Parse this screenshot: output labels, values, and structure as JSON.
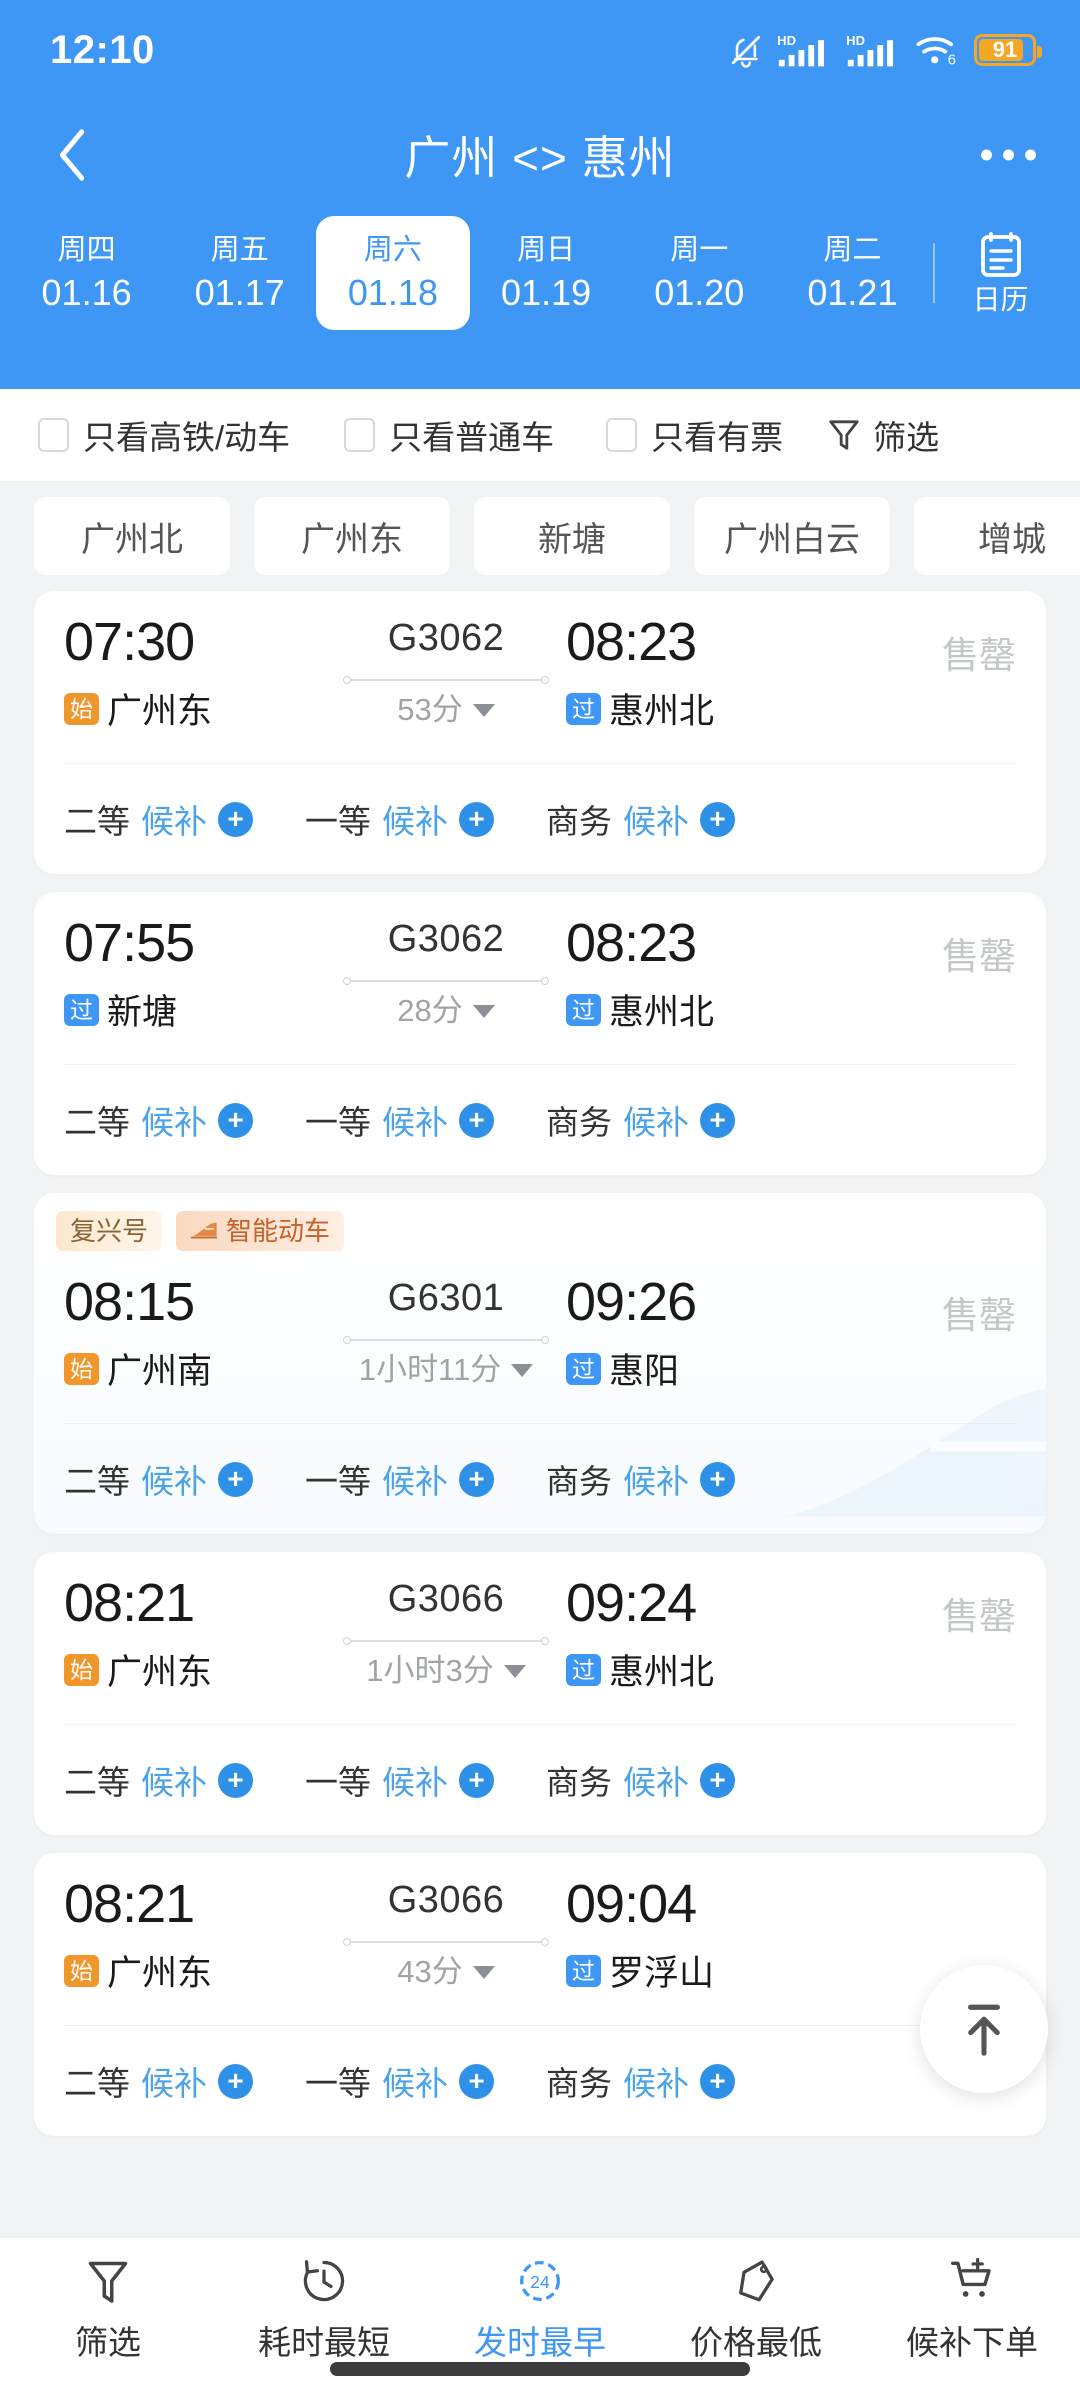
{
  "status_bar": {
    "time": "12:10",
    "battery_percent": "91",
    "icons": [
      "bell-muted-icon",
      "hd-signal-icon",
      "hd-signal-icon",
      "wifi6-icon",
      "battery-icon"
    ]
  },
  "header": {
    "title": "广州 <> 惠州",
    "back_icon": "chevron-left-icon",
    "more_icon": "more-dots-icon",
    "accent_color": "#3E96F5"
  },
  "dates": {
    "tabs": [
      {
        "dow": "周四",
        "date": "01.16",
        "active": false
      },
      {
        "dow": "周五",
        "date": "01.17",
        "active": false
      },
      {
        "dow": "周六",
        "date": "01.18",
        "active": true
      },
      {
        "dow": "周日",
        "date": "01.19",
        "active": false
      },
      {
        "dow": "周一",
        "date": "01.20",
        "active": false
      },
      {
        "dow": "周二",
        "date": "01.21",
        "active": false
      }
    ],
    "calendar_label": "日历",
    "calendar_icon": "calendar-icon"
  },
  "filters": {
    "checks": [
      {
        "label": "只看高铁/动车",
        "checked": false
      },
      {
        "label": "只看普通车",
        "checked": false
      },
      {
        "label": "只看有票",
        "checked": false
      }
    ],
    "filter_button": {
      "label": "筛选",
      "icon": "funnel-icon"
    }
  },
  "stations": {
    "chips": [
      "广州北",
      "广州东",
      "新塘",
      "广州白云",
      "增城"
    ]
  },
  "trains": [
    {
      "badges": [],
      "depart_time": "07:30",
      "depart_badge": "始",
      "depart_badge_type": "start",
      "depart_station": "广州东",
      "train_no": "G3062",
      "duration": "53分",
      "arrive_time": "08:23",
      "arrive_badge": "过",
      "arrive_badge_type": "pass",
      "arrive_station": "惠州北",
      "status": "售罄",
      "seats": [
        {
          "class": "二等",
          "state": "候补",
          "action_icon": "plus-icon"
        },
        {
          "class": "一等",
          "state": "候补",
          "action_icon": "plus-icon"
        },
        {
          "class": "商务",
          "state": "候补",
          "action_icon": "plus-icon"
        }
      ]
    },
    {
      "badges": [],
      "depart_time": "07:55",
      "depart_badge": "过",
      "depart_badge_type": "pass",
      "depart_station": "新塘",
      "train_no": "G3062",
      "duration": "28分",
      "arrive_time": "08:23",
      "arrive_badge": "过",
      "arrive_badge_type": "pass",
      "arrive_station": "惠州北",
      "status": "售罄",
      "seats": [
        {
          "class": "二等",
          "state": "候补",
          "action_icon": "plus-icon"
        },
        {
          "class": "一等",
          "state": "候补",
          "action_icon": "plus-icon"
        },
        {
          "class": "商务",
          "state": "候补",
          "action_icon": "plus-icon"
        }
      ]
    },
    {
      "badges": [
        {
          "label": "复兴号",
          "type": "fx",
          "icon": null
        },
        {
          "label": "智能动车",
          "type": "zn",
          "icon": "train-icon"
        }
      ],
      "depart_time": "08:15",
      "depart_badge": "始",
      "depart_badge_type": "start",
      "depart_station": "广州南",
      "train_no": "G6301",
      "duration": "1小时11分",
      "arrive_time": "09:26",
      "arrive_badge": "过",
      "arrive_badge_type": "pass",
      "arrive_station": "惠阳",
      "status": "售罄",
      "seats": [
        {
          "class": "二等",
          "state": "候补",
          "action_icon": "plus-icon"
        },
        {
          "class": "一等",
          "state": "候补",
          "action_icon": "plus-icon"
        },
        {
          "class": "商务",
          "state": "候补",
          "action_icon": "plus-icon"
        }
      ]
    },
    {
      "badges": [],
      "depart_time": "08:21",
      "depart_badge": "始",
      "depart_badge_type": "start",
      "depart_station": "广州东",
      "train_no": "G3066",
      "duration": "1小时3分",
      "arrive_time": "09:24",
      "arrive_badge": "过",
      "arrive_badge_type": "pass",
      "arrive_station": "惠州北",
      "status": "售罄",
      "seats": [
        {
          "class": "二等",
          "state": "候补",
          "action_icon": "plus-icon"
        },
        {
          "class": "一等",
          "state": "候补",
          "action_icon": "plus-icon"
        },
        {
          "class": "商务",
          "state": "候补",
          "action_icon": "plus-icon"
        }
      ]
    },
    {
      "badges": [],
      "depart_time": "08:21",
      "depart_badge": "始",
      "depart_badge_type": "start",
      "depart_station": "广州东",
      "train_no": "G3066",
      "duration": "43分",
      "arrive_time": "09:04",
      "arrive_badge": "过",
      "arrive_badge_type": "pass",
      "arrive_station": "罗浮山",
      "status": "",
      "seats": [
        {
          "class": "二等",
          "state": "候补",
          "action_icon": "plus-icon"
        },
        {
          "class": "一等",
          "state": "候补",
          "action_icon": "plus-icon"
        },
        {
          "class": "商务",
          "state": "候补",
          "action_icon": "plus-icon"
        }
      ]
    }
  ],
  "scroll_top_button": {
    "icon": "scroll-to-top-icon"
  },
  "bottom_bar": {
    "items": [
      {
        "label": "筛选",
        "icon": "funnel-icon",
        "active": false
      },
      {
        "label": "耗时最短",
        "icon": "clock-icon",
        "active": false
      },
      {
        "label": "发时最早",
        "icon": "clock24-icon",
        "active": true,
        "badge": "24"
      },
      {
        "label": "价格最低",
        "icon": "price-tag-icon",
        "active": false
      },
      {
        "label": "候补下单",
        "icon": "cart-plus-icon",
        "active": false
      }
    ]
  }
}
